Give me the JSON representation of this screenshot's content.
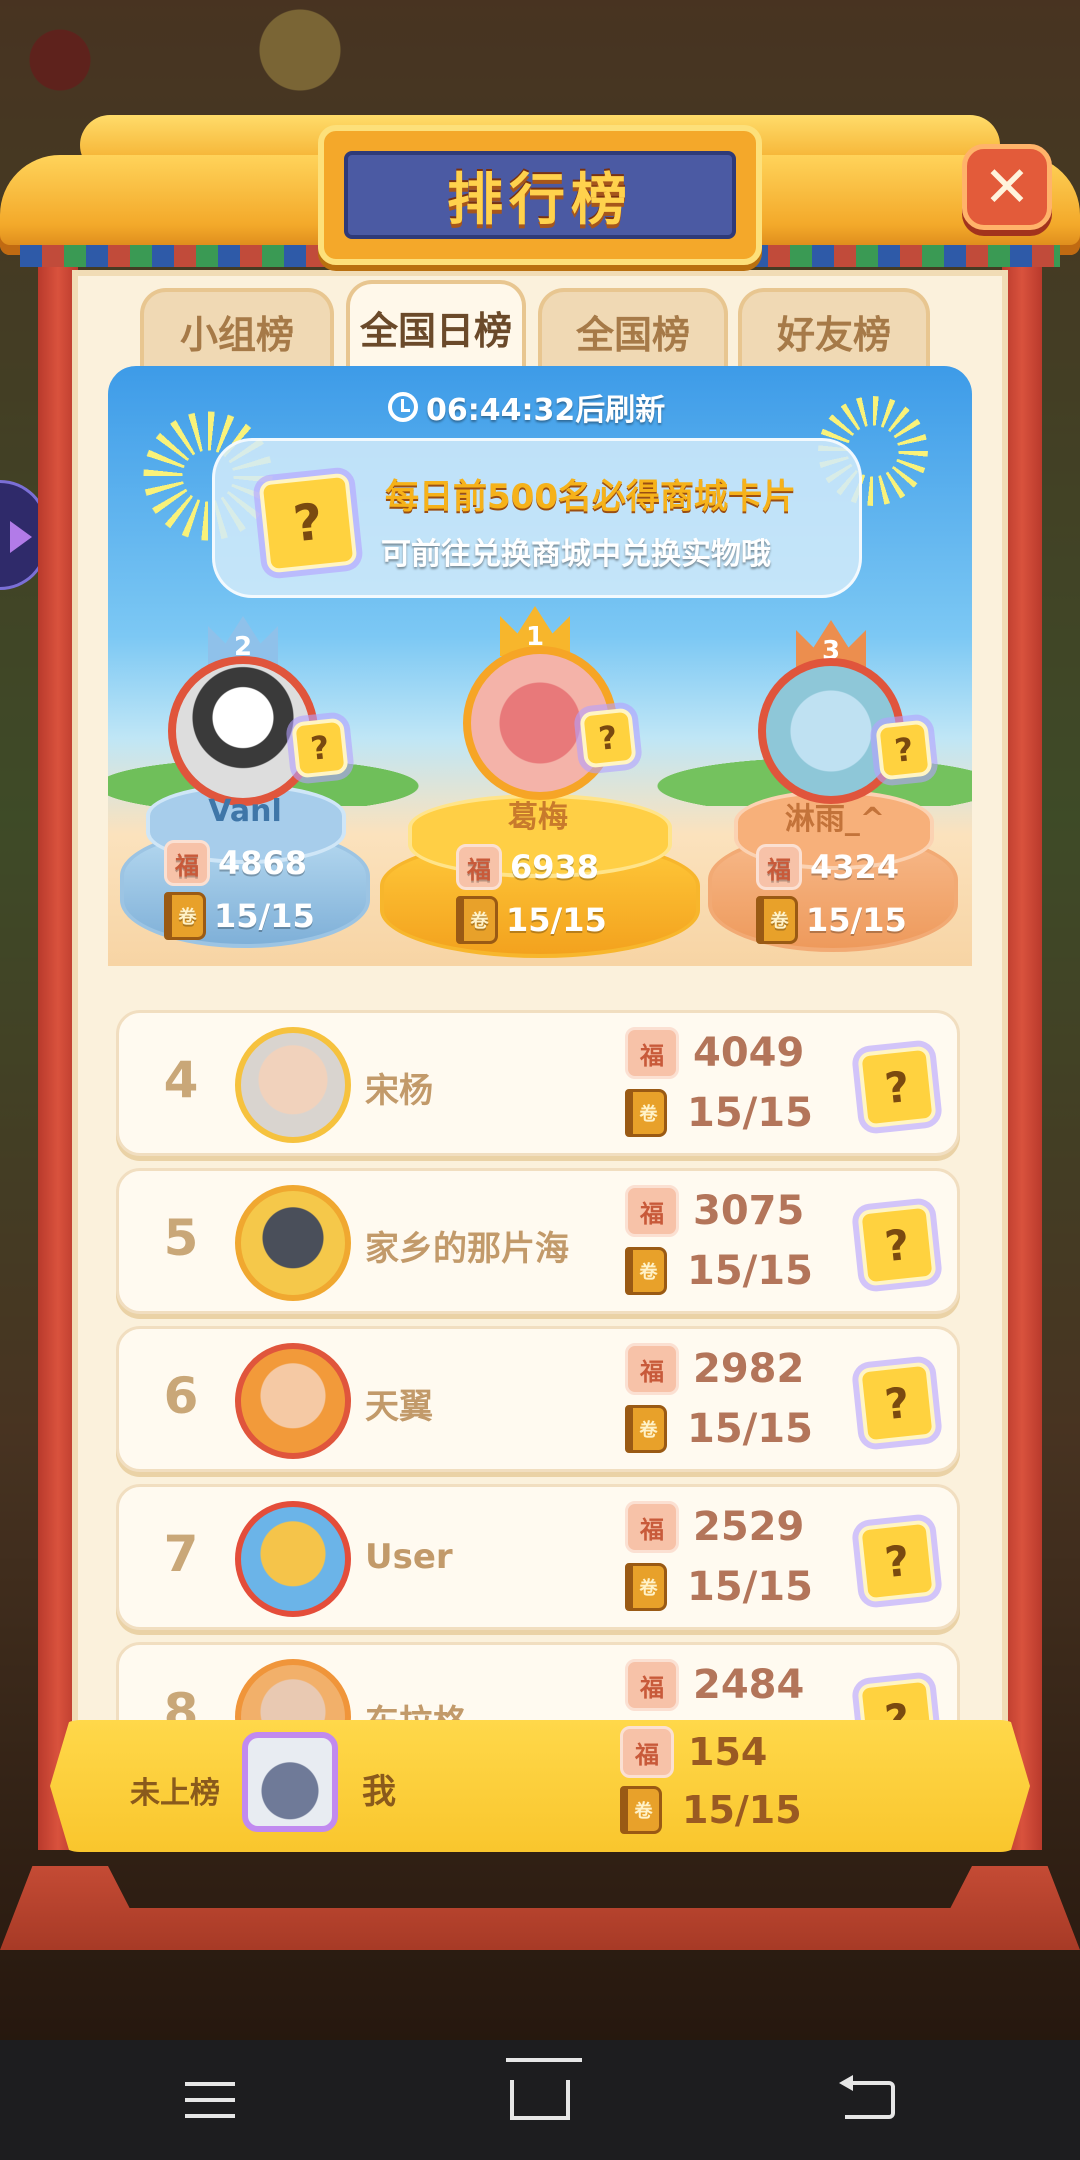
{
  "title": "排行榜",
  "close_label": "✕",
  "tabs": [
    {
      "label": "小组榜",
      "active": false
    },
    {
      "label": "全国日榜",
      "active": true
    },
    {
      "label": "全国榜",
      "active": false
    },
    {
      "label": "好友榜",
      "active": false
    }
  ],
  "banner": {
    "refresh_text": "06:44:32后刷新",
    "notice_line1": "每日前500名必得商城卡片",
    "notice_line2": "可前往兑换商城中兑换实物哦"
  },
  "podium": [
    {
      "rank": "2",
      "name": "Vanl",
      "score": "4868",
      "progress": "15/15"
    },
    {
      "rank": "1",
      "name": "葛梅",
      "score": "6938",
      "progress": "15/15"
    },
    {
      "rank": "3",
      "name": "淋雨_^",
      "score": "4324",
      "progress": "15/15"
    }
  ],
  "list": [
    {
      "rank": "4",
      "name": "宋杨",
      "score": "4049",
      "progress": "15/15"
    },
    {
      "rank": "5",
      "name": "家乡的那片海",
      "score": "3075",
      "progress": "15/15"
    },
    {
      "rank": "6",
      "name": "天翼",
      "score": "2982",
      "progress": "15/15"
    },
    {
      "rank": "7",
      "name": "User",
      "score": "2529",
      "progress": "15/15"
    },
    {
      "rank": "8",
      "name": "东拉格",
      "score": "2484",
      "progress": ""
    }
  ],
  "me": {
    "status": "未上榜",
    "name": "我",
    "score": "154",
    "progress": "15/15"
  },
  "icons": {
    "fu": "福",
    "book": "卷",
    "card": "?"
  },
  "colors": {
    "accent": "#f9c62d",
    "title_plate": "#4b5aa3",
    "frame": "#d9523d"
  }
}
